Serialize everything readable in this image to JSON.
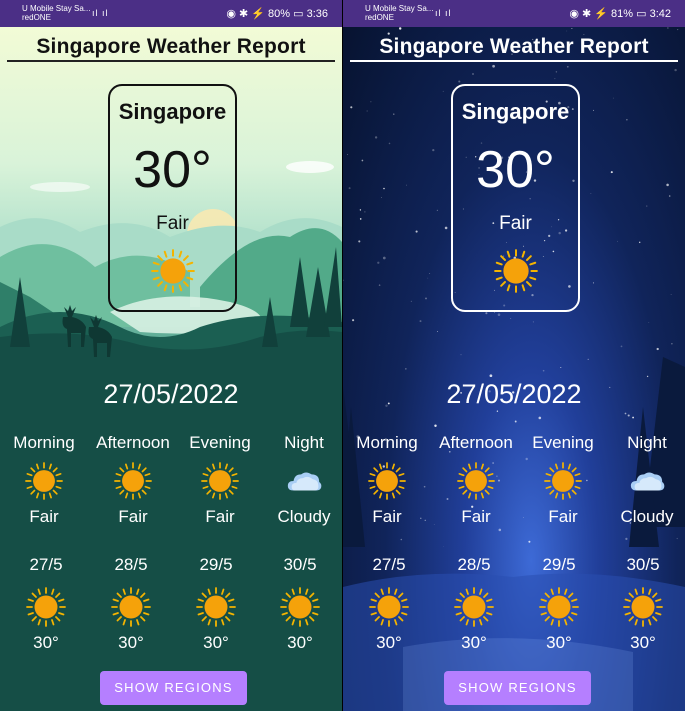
{
  "left": {
    "status": {
      "carrier1": "U Mobile Stay Sa...",
      "carrier2": "redONE",
      "signal": "ıl ıl",
      "right": "◉ ✱ ⚡ 80% ▭ 3:36"
    },
    "title": "Singapore Weather Report",
    "card": {
      "city": "Singapore",
      "temp": "30°",
      "condition": "Fair",
      "icon": "sun-icon"
    },
    "date": "27/05/2022",
    "periods": [
      {
        "label": "Morning",
        "condition": "Fair",
        "icon": "sun-icon"
      },
      {
        "label": "Afternoon",
        "condition": "Fair",
        "icon": "sun-icon"
      },
      {
        "label": "Evening",
        "condition": "Fair",
        "icon": "sun-icon"
      },
      {
        "label": "Night",
        "condition": "Cloudy",
        "icon": "cloud-icon"
      }
    ],
    "days": [
      {
        "date": "27/5",
        "temp": "30°",
        "icon": "sun-icon"
      },
      {
        "date": "28/5",
        "temp": "30°",
        "icon": "sun-icon"
      },
      {
        "date": "29/5",
        "temp": "30°",
        "icon": "sun-icon"
      },
      {
        "date": "30/5",
        "temp": "30°",
        "icon": "sun-icon"
      }
    ],
    "button": "SHOW REGIONS"
  },
  "right": {
    "status": {
      "carrier1": "U Mobile Stay Sa...",
      "carrier2": "redONE",
      "signal": "ıl ıl",
      "right": "◉ ✱ ⚡ 81% ▭ 3:42"
    },
    "title": "Singapore Weather Report",
    "card": {
      "city": "Singapore",
      "temp": "30°",
      "condition": "Fair",
      "icon": "sun-icon"
    },
    "date": "27/05/2022",
    "periods": [
      {
        "label": "Morning",
        "condition": "Fair",
        "icon": "sun-icon"
      },
      {
        "label": "Afternoon",
        "condition": "Fair",
        "icon": "sun-icon"
      },
      {
        "label": "Evening",
        "condition": "Fair",
        "icon": "sun-icon"
      },
      {
        "label": "Night",
        "condition": "Cloudy",
        "icon": "cloud-icon"
      }
    ],
    "days": [
      {
        "date": "27/5",
        "temp": "30°",
        "icon": "sun-icon"
      },
      {
        "date": "28/5",
        "temp": "30°",
        "icon": "sun-icon"
      },
      {
        "date": "29/5",
        "temp": "30°",
        "icon": "sun-icon"
      },
      {
        "date": "30/5",
        "temp": "30°",
        "icon": "sun-icon"
      }
    ],
    "button": "SHOW REGIONS"
  },
  "colors": {
    "accent_button": "#b57fff",
    "sun": "#f5a20a",
    "status_bar": "#4b2f86"
  }
}
